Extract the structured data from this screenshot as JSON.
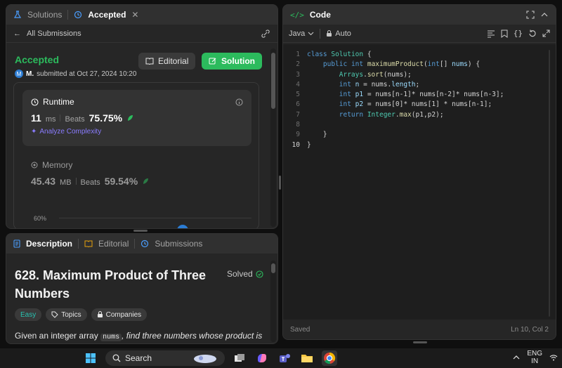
{
  "submission_panel": {
    "tab_solutions": "Solutions",
    "tab_accepted": "Accepted",
    "back_label": "All Submissions",
    "status": "Accepted",
    "avatar_letter": "M",
    "user": "M.",
    "submitted_at": "submitted at Oct 27, 2024 10:20",
    "editorial_button": "Editorial",
    "solution_button": "Solution",
    "runtime_label": "Runtime",
    "runtime_value": "11",
    "runtime_unit": "ms",
    "beats_label": "Beats",
    "runtime_beats": "75.75%",
    "analyze_label": "Analyze Complexity",
    "memory_label": "Memory",
    "memory_value": "45.43",
    "memory_unit": "MB",
    "memory_beats": "59.54%",
    "chart_tick": "60%"
  },
  "description_panel": {
    "tab_description": "Description",
    "tab_editorial": "Editorial",
    "tab_submissions": "Submissions",
    "title": "628. Maximum Product of Three Numbers",
    "solved": "Solved",
    "tag_easy": "Easy",
    "tag_topics": "Topics",
    "tag_companies": "Companies",
    "text_before": "Given an integer array",
    "text_code": "nums",
    "text_after": ", find three numbers whose product is"
  },
  "code_panel": {
    "title": "Code",
    "language": "Java",
    "mode": "Auto",
    "status_left": "Saved",
    "status_right": "Ln 10, Col 2",
    "lines": [
      "1",
      "2",
      "3",
      "4",
      "5",
      "6",
      "7",
      "8",
      "9",
      "10"
    ]
  },
  "taskbar": {
    "search_label": "Search",
    "lang_top": "ENG",
    "lang_bottom": "IN"
  },
  "colors": {
    "accent_green": "#2cbb5d",
    "link_blue": "#2b7cd3",
    "analyze_purple": "#8a7cff"
  }
}
